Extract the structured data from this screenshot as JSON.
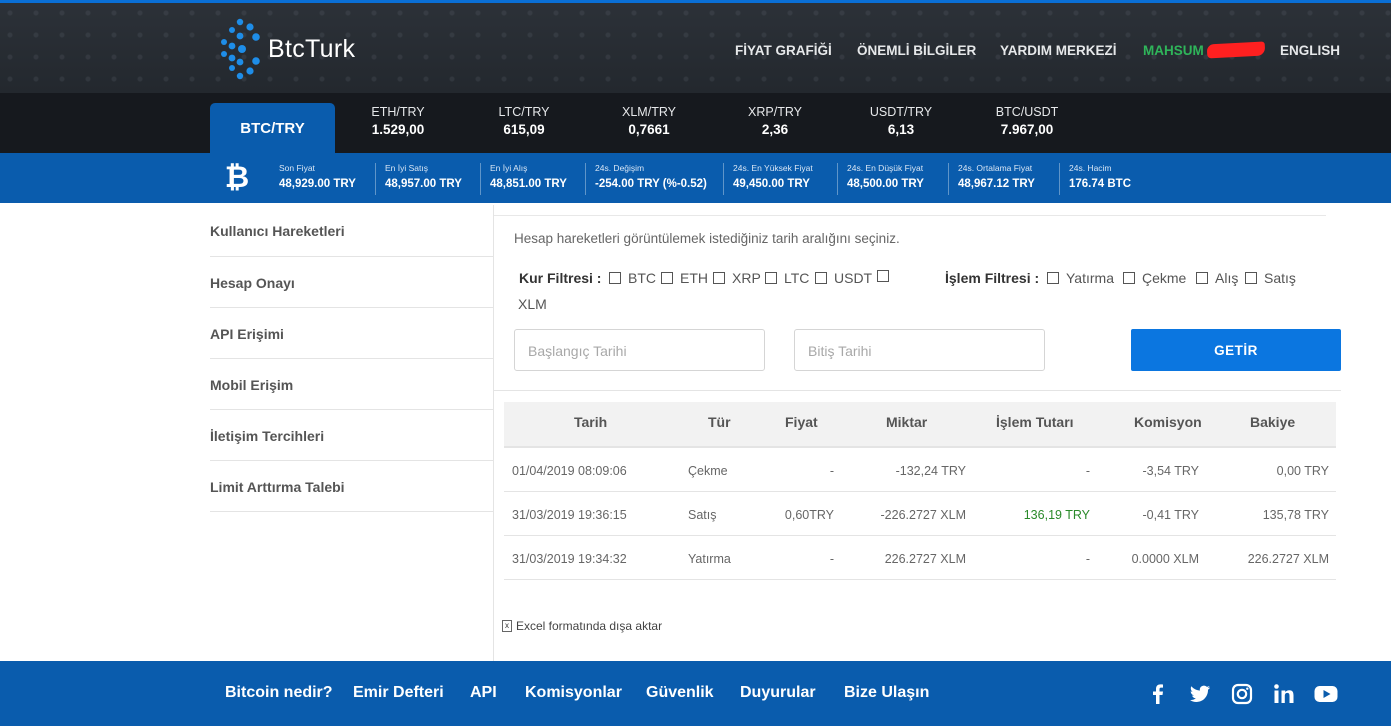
{
  "header": {
    "brand": "BtcTurk",
    "nav": [
      "FİYAT GRAFİĞİ",
      "ÖNEMLİ BİLGİLER",
      "YARDIM MERKEZİ"
    ],
    "user": "MAHSUM",
    "language": "ENGLISH"
  },
  "pairs": {
    "active": "BTC/TRY",
    "items": [
      {
        "name": "ETH/TRY",
        "price": "1.529,00"
      },
      {
        "name": "LTC/TRY",
        "price": "615,09"
      },
      {
        "name": "XLM/TRY",
        "price": "0,7661"
      },
      {
        "name": "XRP/TRY",
        "price": "2,36"
      },
      {
        "name": "USDT/TRY",
        "price": "6,13"
      },
      {
        "name": "BTC/USDT",
        "price": "7.967,00"
      }
    ]
  },
  "stats": [
    {
      "label": "Son Fiyat",
      "value": "48,929.00 TRY"
    },
    {
      "label": "En İyi Satış",
      "value": "48,957.00 TRY"
    },
    {
      "label": "En İyi Alış",
      "value": "48,851.00 TRY"
    },
    {
      "label": "24s. Değişim",
      "value": "-254.00 TRY (%-0.52)"
    },
    {
      "label": "24s. En Yüksek Fiyat",
      "value": "49,450.00 TRY"
    },
    {
      "label": "24s. En Düşük Fiyat",
      "value": "48,500.00 TRY"
    },
    {
      "label": "24s. Ortalama Fiyat",
      "value": "48,967.12 TRY"
    },
    {
      "label": "24s. Hacim",
      "value": "176.74 BTC"
    }
  ],
  "sidebar": {
    "items": [
      "Kullanıcı Hareketleri",
      "Hesap Onayı",
      "API Erişimi",
      "Mobil Erişim",
      "İletişim Tercihleri",
      "Limit Arttırma Talebi"
    ]
  },
  "main": {
    "intro": "Hesap hareketleri görüntülemek istediğiniz tarih aralığını seçiniz.",
    "currency_filter_label": "Kur Filtresi :",
    "currency_options": [
      "BTC",
      "ETH",
      "XRP",
      "LTC",
      "USDT",
      "XLM"
    ],
    "tx_filter_label": "İşlem Filtresi :",
    "tx_options": [
      "Yatırma",
      "Çekme",
      "Alış",
      "Satış"
    ],
    "start_placeholder": "Başlangıç Tarihi",
    "end_placeholder": "Bitiş Tarihi",
    "submit_label": "GETİR",
    "excel_label": "Excel formatında dışa aktar"
  },
  "table": {
    "headers": [
      "Tarih",
      "Tür",
      "Fiyat",
      "Miktar",
      "İşlem Tutarı",
      "Komisyon",
      "Bakiye"
    ],
    "rows": [
      [
        "01/04/2019 08:09:06",
        "Çekme",
        "-",
        "-132,24 TRY",
        "-",
        "-3,54 TRY",
        "0,00 TRY"
      ],
      [
        "31/03/2019 19:36:15",
        "Satış",
        "0,60TRY",
        "-226.2727 XLM",
        "136,19 TRY",
        "-0,41 TRY",
        "135,78 TRY"
      ],
      [
        "31/03/2019 19:34:32",
        "Yatırma",
        "-",
        "226.2727 XLM",
        "-",
        "0.0000 XLM",
        "226.2727 XLM"
      ]
    ]
  },
  "footer": {
    "links": [
      "Bitcoin nedir?",
      "Emir Defteri",
      "API",
      "Komisyonlar",
      "Güvenlik",
      "Duyurular",
      "Bize Ulaşın"
    ],
    "social": [
      "facebook-icon",
      "twitter-icon",
      "instagram-icon",
      "linkedin-icon",
      "youtube-icon"
    ]
  },
  "colors": {
    "brand_blue": "#0a5cad",
    "button_blue": "#0b76e0",
    "user_green": "#2fb55a",
    "positive_green": "#2a8a2a"
  }
}
